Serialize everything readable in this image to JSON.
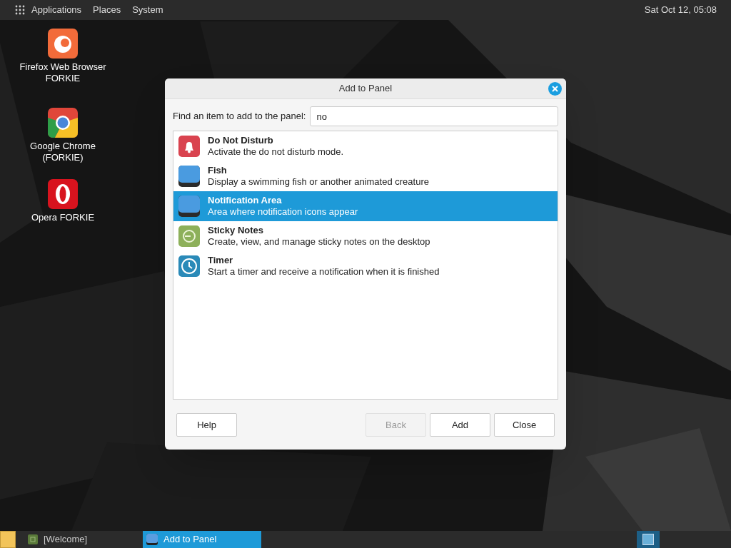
{
  "top_panel": {
    "menus": [
      "Applications",
      "Places",
      "System"
    ],
    "clock": "Sat Oct 12, 05:08"
  },
  "desktop_icons": [
    {
      "kind": "firefox",
      "label": "Firefox Web Browser FORKIE"
    },
    {
      "kind": "chrome",
      "label": "Google Chrome (FORKIE)"
    },
    {
      "kind": "opera",
      "label": "Opera FORKIE"
    }
  ],
  "dialog": {
    "title": "Add to Panel",
    "search_label": "Find an item to add to the panel:",
    "search_value": "no",
    "items": [
      {
        "kind": "bell",
        "name": "Do Not Disturb",
        "description": "Activate the do not disturb mode.",
        "selected": false
      },
      {
        "kind": "blank",
        "name": "Fish",
        "description": "Display a swimming fish or another animated creature",
        "selected": false
      },
      {
        "kind": "blank",
        "name": "Notification Area",
        "description": "Area where notification icons appear",
        "selected": true
      },
      {
        "kind": "sticky",
        "name": "Sticky Notes",
        "description": "Create, view, and manage sticky notes on the desktop",
        "selected": false
      },
      {
        "kind": "timer",
        "name": "Timer",
        "description": "Start a timer and receive a notification when it is finished",
        "selected": false
      }
    ],
    "buttons": [
      {
        "label": "Help",
        "disabled": false
      },
      {
        "label": "Back",
        "disabled": true
      },
      {
        "label": "Add",
        "disabled": false
      },
      {
        "label": "Close",
        "disabled": false
      }
    ]
  },
  "taskbar": {
    "windows": [
      {
        "kind": "welcome",
        "label": "[Welcome]",
        "selected": false
      },
      {
        "kind": "panel",
        "label": "Add to Panel",
        "selected": true
      }
    ]
  }
}
